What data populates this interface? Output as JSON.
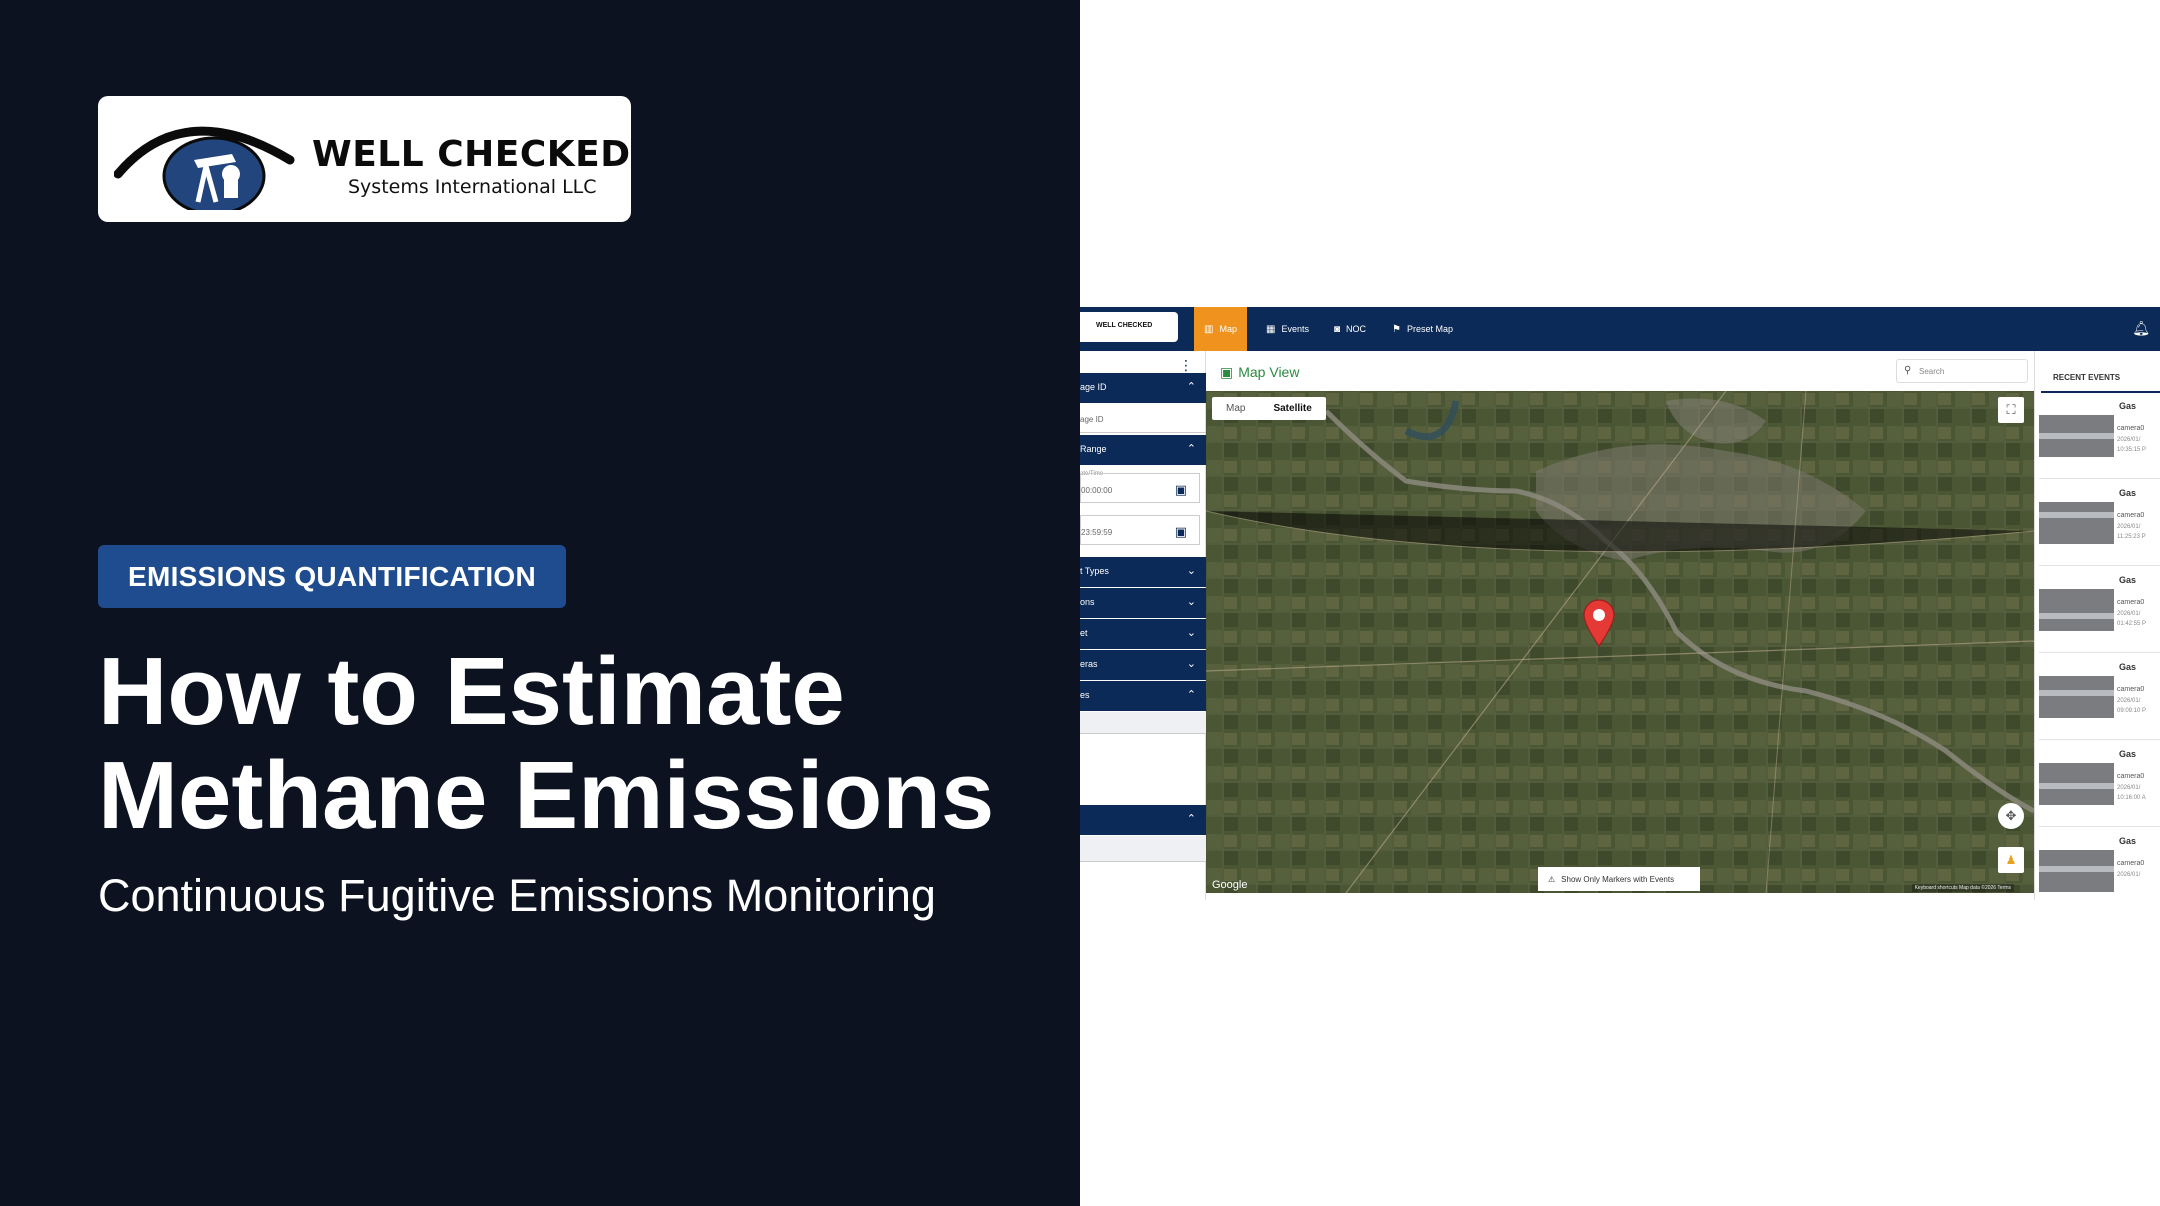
{
  "logo": {
    "name": "WELL CHECKED",
    "subtitle": "Systems International LLC"
  },
  "hero": {
    "category": "EMISSIONS QUANTIFICATION",
    "title_line1": "How to Estimate",
    "title_line2": "Methane Emissions",
    "subtitle": "Continuous Fugitive Emissions Monitoring"
  },
  "app": {
    "nav": {
      "logo_text": "WELL CHECKED",
      "tabs": [
        {
          "label": "Map",
          "icon": "map-icon",
          "active": true
        },
        {
          "label": "Events",
          "icon": "calendar-icon",
          "active": false
        },
        {
          "label": "NOC",
          "icon": "camera-icon",
          "active": false
        },
        {
          "label": "Preset Map",
          "icon": "preset-map-icon",
          "active": false
        }
      ],
      "bell_icon": "bell-icon"
    },
    "sidebar": {
      "sections": [
        {
          "label": "age ID",
          "expanded": true
        },
        {
          "label": "Range",
          "expanded": true
        },
        {
          "label": "t Types",
          "expanded": false
        },
        {
          "label": "ons",
          "expanded": false
        },
        {
          "label": "et",
          "expanded": false
        },
        {
          "label": "eras",
          "expanded": false
        },
        {
          "label": "es",
          "expanded": true
        },
        {
          "label": "",
          "expanded": true
        }
      ],
      "image_id_placeholder": "age ID",
      "date_label": "ate/Time",
      "start_time": "00:00:00",
      "end_time": "23:59:59"
    },
    "main": {
      "title": "Map View",
      "search_placeholder": "Search",
      "map_type_options": [
        "Map",
        "Satellite"
      ],
      "map_type_selected": "Satellite",
      "markers_toggle_label": "Show Only Markers with Events",
      "google_mark": "Google",
      "attribution": "Keyboard shortcuts  Map data ©2026  Terms"
    },
    "recent_events": {
      "title": "RECENT EVENTS",
      "items": [
        {
          "type": "Gas",
          "camera": "camera0",
          "date": "2026/01/",
          "time": "10:35:15 P"
        },
        {
          "type": "Gas",
          "camera": "camera0",
          "date": "2026/01/",
          "time": "11:25:23 P"
        },
        {
          "type": "Gas",
          "camera": "camera0",
          "date": "2026/01/",
          "time": "01:42:55 P"
        },
        {
          "type": "Gas",
          "camera": "camera0",
          "date": "2026/01/",
          "time": "09:09:10 P"
        },
        {
          "type": "Gas",
          "camera": "camera0",
          "date": "2026/01/",
          "time": "10:16:00 A"
        },
        {
          "type": "Gas",
          "camera": "camera0",
          "date": "2026/01/",
          "time": ""
        }
      ]
    }
  },
  "colors": {
    "hero_bg": "#0d1220",
    "badge_bg": "#1f4c8f",
    "nav_bg": "#0c2a57",
    "nav_active": "#f0931e",
    "map_title": "#2a8a3e",
    "pin": "#e53935"
  }
}
